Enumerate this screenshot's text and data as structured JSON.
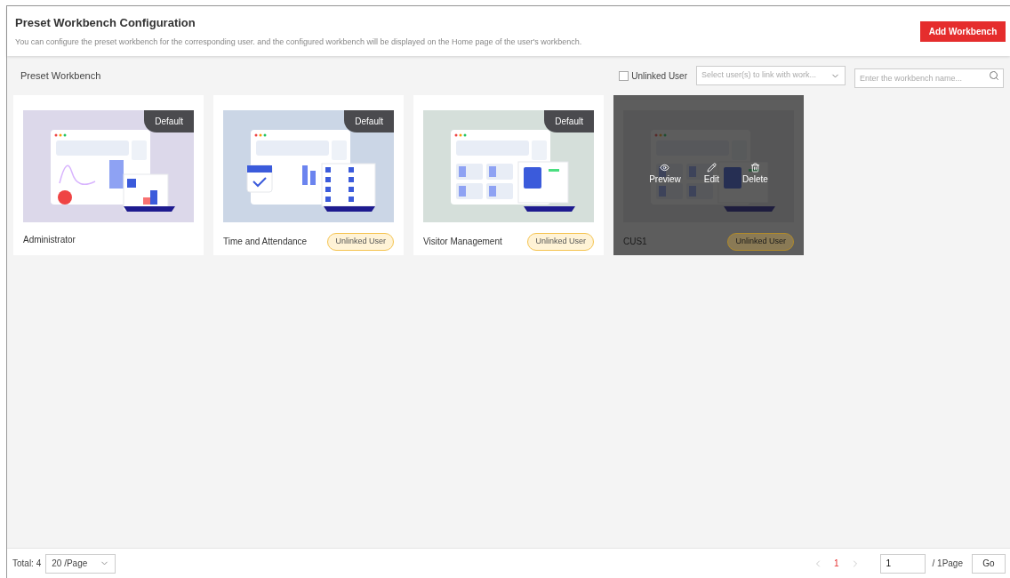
{
  "header": {
    "title": "Preset Workbench Configuration",
    "description": "You can configure the preset workbench for the corresponding user. and the configured workbench will be displayed on the Home page of the user's workbench.",
    "add_button": "Add Workbench"
  },
  "toolbar": {
    "title": "Preset Workbench",
    "unlinked_filter": {
      "label": "Unlinked User",
      "checked": false
    },
    "user_select": {
      "placeholder": "Select user(s) to link with work..."
    },
    "search": {
      "placeholder": "Enter the workbench name..."
    }
  },
  "cards": [
    {
      "name": "Administrator",
      "kind": "admin",
      "default_badge": "Default",
      "hovered": false
    },
    {
      "name": "Time and Attendance",
      "kind": "attendance",
      "default_badge": "Default",
      "unlinked_badge": "Unlinked User",
      "hovered": false
    },
    {
      "name": "Visitor Management",
      "kind": "visitor",
      "default_badge": "Default",
      "unlinked_badge": "Unlinked User",
      "hovered": false
    },
    {
      "name": "CUS1",
      "kind": "custom",
      "unlinked_badge": "Unlinked User",
      "hovered": true,
      "actions": [
        {
          "kind": "preview",
          "label": "Preview"
        },
        {
          "kind": "edit",
          "label": "Edit"
        },
        {
          "kind": "delete",
          "label": "Delete"
        }
      ]
    }
  ],
  "footer": {
    "total": "Total: 4",
    "page_size": "20 /Page",
    "pages": [
      {
        "label": "1",
        "selected": true
      }
    ],
    "prev_disabled": true,
    "next_disabled": true,
    "jump_value": "1",
    "page_count": "/ 1Page",
    "go_button": "Go"
  }
}
